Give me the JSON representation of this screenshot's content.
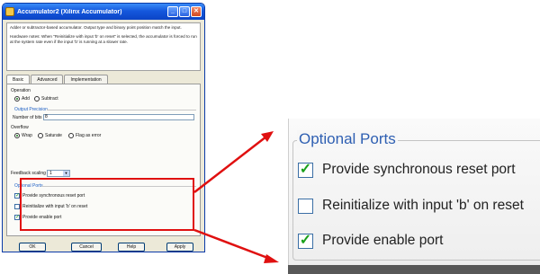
{
  "window": {
    "title": "Accumulator2 (Xilinx Accumulator)",
    "description_1": "Adder or subtractor-based accumulator. Output type and binary point position match the input.",
    "description_2": "Hardware notes: When \"Reinitialize with input 'b' on reset\" is selected, the accumulator is forced to run at the system rate even if the input 'b' is running at a slower rate."
  },
  "tabs": [
    "Basic",
    "Advanced",
    "Implementation"
  ],
  "basic": {
    "operation_label": "Operation",
    "operation_options": [
      "Add",
      "Subtract"
    ],
    "operation_selected": "Add",
    "output_precision_label": "Output Precision",
    "number_of_bits_label": "Number of bits",
    "number_of_bits_value": "8",
    "overflow_label": "Overflow",
    "overflow_options": [
      "Wrap",
      "Saturate",
      "Flag as error"
    ],
    "overflow_selected": "Wrap",
    "feedback_scaling_label": "Feedback scaling",
    "feedback_scaling_value": "1"
  },
  "optional_ports": {
    "title": "Optional Ports",
    "items": [
      {
        "label": "Provide synchronous reset port",
        "checked": true
      },
      {
        "label": "Reinitialize with input 'b' on reset",
        "checked": false
      },
      {
        "label": "Provide enable port",
        "checked": true
      }
    ]
  },
  "buttons": {
    "ok": "OK",
    "cancel": "Cancel",
    "help": "Help",
    "apply": "Apply"
  },
  "colors": {
    "highlight": "#e01010",
    "check": "#1aa01a",
    "group_title": "#2e5fb2"
  }
}
